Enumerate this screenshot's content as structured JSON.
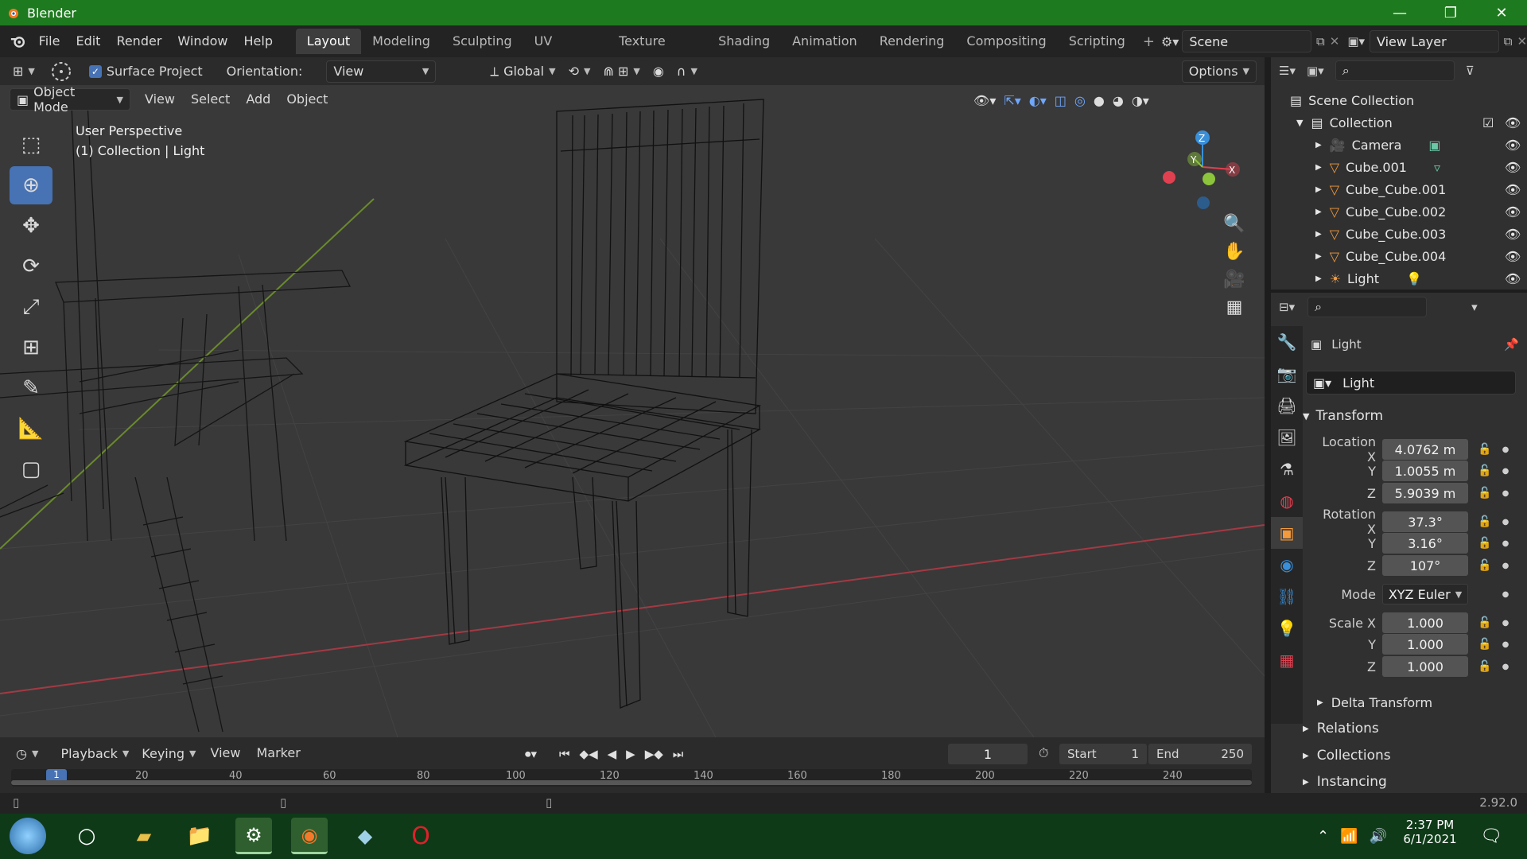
{
  "window": {
    "title": "Blender",
    "min": "—",
    "max": "❐",
    "close": "✕"
  },
  "menu": [
    "File",
    "Edit",
    "Render",
    "Window",
    "Help"
  ],
  "workspaces": [
    "Layout",
    "Modeling",
    "Sculpting",
    "UV Editing",
    "Texture Paint",
    "Shading",
    "Animation",
    "Rendering",
    "Compositing",
    "Scripting"
  ],
  "scene": {
    "scene_name": "Scene",
    "view_layer": "View Layer"
  },
  "toolheader": {
    "surface_project": "Surface Project",
    "orientation_label": "Orientation:",
    "orientation_value": "View",
    "transform_space": "Global",
    "options": "Options"
  },
  "vpheader": {
    "mode": "Object Mode",
    "menus": [
      "View",
      "Select",
      "Add",
      "Object"
    ]
  },
  "viewport": {
    "perspective": "User Perspective",
    "context": "(1) Collection | Light"
  },
  "gizmo": {
    "z": "Z",
    "y": "Y",
    "x": "X"
  },
  "outliner": {
    "root": "Scene Collection",
    "collection": "Collection",
    "items": [
      "Camera",
      "Cube.001",
      "Cube_Cube.001",
      "Cube_Cube.002",
      "Cube_Cube.003",
      "Cube_Cube.004",
      "Light"
    ]
  },
  "properties": {
    "object_name": "Light",
    "datablock": "Light",
    "transform_header": "Transform",
    "location_label": "Location X",
    "rotation_label": "Rotation X",
    "scale_label": "Scale X",
    "y_label": "Y",
    "z_label": "Z",
    "location": [
      "4.0762 m",
      "1.0055 m",
      "5.9039 m"
    ],
    "rotation": [
      "37.3°",
      "3.16°",
      "107°"
    ],
    "mode_label": "Mode",
    "mode_value": "XYZ Euler",
    "scale": [
      "1.000",
      "1.000",
      "1.000"
    ],
    "sections": [
      "Delta Transform",
      "Relations",
      "Collections",
      "Instancing"
    ]
  },
  "timeline": {
    "menus": [
      "Playback",
      "Keying",
      "View",
      "Marker"
    ],
    "current_frame": "1",
    "start_label": "Start",
    "start_value": "1",
    "end_label": "End",
    "end_value": "250",
    "ruler": [
      "1",
      "20",
      "40",
      "60",
      "80",
      "100",
      "120",
      "140",
      "160",
      "180",
      "200",
      "220",
      "240"
    ]
  },
  "status": {
    "version": "2.92.0"
  },
  "taskbar": {
    "time": "2:37 PM",
    "date": "6/1/2021"
  },
  "colors": {
    "titlebar": "#1e7a1e",
    "taskbar": "#0f3a18",
    "active_tool": "#4772b3",
    "axis_x": "#e04050",
    "axis_y": "#8cc43c",
    "axis_z": "#3a8fd9"
  }
}
